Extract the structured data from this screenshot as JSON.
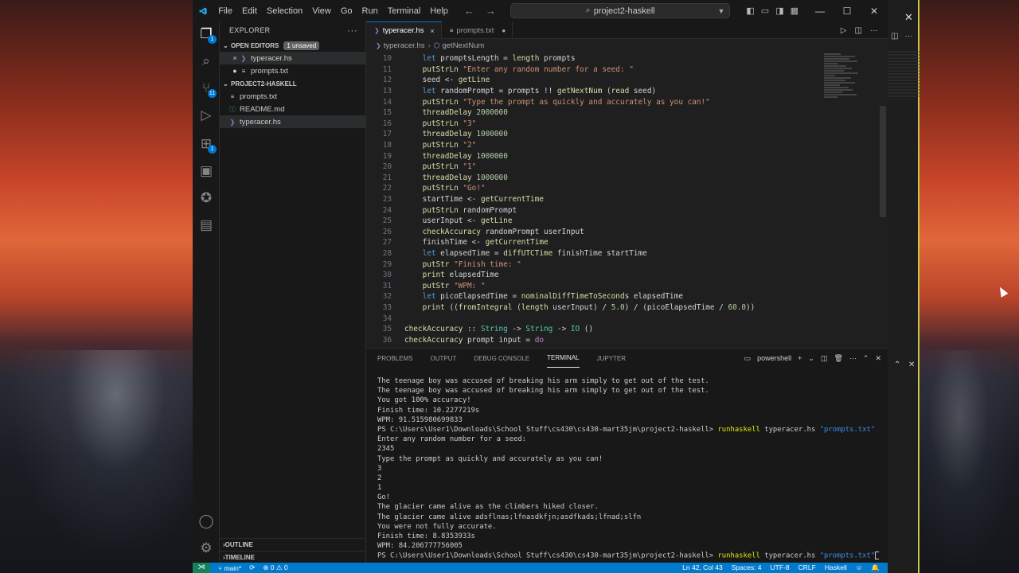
{
  "titlebar": {
    "menu": [
      "File",
      "Edit",
      "Selection",
      "View",
      "Go",
      "Run",
      "Terminal",
      "Help"
    ],
    "search_text": "project2-haskell"
  },
  "sidebar": {
    "header": "EXPLORER",
    "open_editors_label": "OPEN EDITORS",
    "unsaved_badge": "1 unsaved",
    "open_editors": [
      {
        "name": "typeracer.hs",
        "marker": "×"
      },
      {
        "name": "prompts.txt",
        "marker": "●"
      }
    ],
    "project_label": "PROJECT2-HASKELL",
    "files": [
      {
        "name": "prompts.txt"
      },
      {
        "name": "README.md"
      },
      {
        "name": "typeracer.hs"
      }
    ],
    "outline_label": "OUTLINE",
    "timeline_label": "TIMELINE"
  },
  "activity_badges": {
    "source_control": "11",
    "extensions": "1"
  },
  "tabs": [
    {
      "label": "typeracer.hs"
    },
    {
      "label": "prompts.txt"
    }
  ],
  "breadcrumb": {
    "file": "typeracer.hs",
    "symbol": "getNextNum"
  },
  "code_lines": [
    {
      "n": "10",
      "html": "    <span class='kw'>let</span> promptsLength = <span class='fn'>length</span> prompts"
    },
    {
      "n": "11",
      "html": "    <span class='fn'>putStrLn</span> <span class='str'>\"Enter any random number for a seed: \"</span>"
    },
    {
      "n": "12",
      "html": "    seed <- <span class='fn'>getLine</span>"
    },
    {
      "n": "13",
      "html": "    <span class='kw'>let</span> randomPrompt = prompts !! <span class='fn'>getNextNum</span> (<span class='fn'>read</span> seed)"
    },
    {
      "n": "14",
      "html": "    <span class='fn'>putStrLn</span> <span class='str'>\"Type the prompt as quickly and accurately as you can!\"</span>"
    },
    {
      "n": "15",
      "html": "    <span class='fn'>threadDelay</span> <span class='num'>2000000</span>"
    },
    {
      "n": "16",
      "html": "    <span class='fn'>putStrLn</span> <span class='str'>\"3\"</span>"
    },
    {
      "n": "17",
      "html": "    <span class='fn'>threadDelay</span> <span class='num'>1000000</span>"
    },
    {
      "n": "18",
      "html": "    <span class='fn'>putStrLn</span> <span class='str'>\"2\"</span>"
    },
    {
      "n": "19",
      "html": "    <span class='fn'>threadDelay</span> <span class='num'>1000000</span>"
    },
    {
      "n": "20",
      "html": "    <span class='fn'>putStrLn</span> <span class='str'>\"1\"</span>"
    },
    {
      "n": "21",
      "html": "    <span class='fn'>threadDelay</span> <span class='num'>1000000</span>"
    },
    {
      "n": "22",
      "html": "    <span class='fn'>putStrLn</span> <span class='str'>\"Go!\"</span>"
    },
    {
      "n": "23",
      "html": "    startTime <- <span class='fn'>getCurrentTime</span>"
    },
    {
      "n": "24",
      "html": "    <span class='fn'>putStrLn</span> randomPrompt"
    },
    {
      "n": "25",
      "html": "    userInput <- <span class='fn'>getLine</span>"
    },
    {
      "n": "26",
      "html": "    <span class='fn'>checkAccuracy</span> randomPrompt userInput"
    },
    {
      "n": "27",
      "html": "    finishTime <- <span class='fn'>getCurrentTime</span>"
    },
    {
      "n": "28",
      "html": "    <span class='kw'>let</span> elapsedTime = <span class='fn'>diffUTCTime</span> finishTime startTime"
    },
    {
      "n": "29",
      "html": "    <span class='fn'>putStr</span> <span class='str'>\"Finish time: \"</span>"
    },
    {
      "n": "30",
      "html": "    <span class='fn'>print</span> elapsedTime"
    },
    {
      "n": "31",
      "html": "    <span class='fn'>putStr</span> <span class='str'>\"WPM: \"</span>"
    },
    {
      "n": "32",
      "html": "    <span class='kw'>let</span> picoElapsedTime = <span class='fn'>nominalDiffTimeToSeconds</span> elapsedTime"
    },
    {
      "n": "33",
      "html": "    <span class='fn'>print</span> ((<span class='fn'>fromIntegral</span> (<span class='fn'>length</span> userInput) / <span class='num'>5.0</span>) / (picoElapsedTime / <span class='num'>60.0</span>))"
    },
    {
      "n": "34",
      "html": ""
    },
    {
      "n": "35",
      "html": "<span class='fn'>checkAccuracy</span> :: <span class='ty'>String</span> -> <span class='ty'>String</span> -> <span class='ty'>IO</span> ()"
    },
    {
      "n": "36",
      "html": "<span class='fn'>checkAccuracy</span> prompt input = <span class='kw2'>do</span>"
    }
  ],
  "panel": {
    "tabs": [
      "PROBLEMS",
      "OUTPUT",
      "DEBUG CONSOLE",
      "TERMINAL",
      "JUPYTER"
    ],
    "shell_label": "powershell"
  },
  "terminal": {
    "lines_before": [
      "The teenage boy was accused of breaking his arm simply to get out of the test.",
      "The teenage boy was accused of breaking his arm simply to get out of the test.",
      "You got 100% accuracy!",
      "Finish time: 10.2277219s",
      "WPM: 91.515980699833"
    ],
    "prompt_path": "PS C:\\Users\\User1\\Downloads\\School Stuff\\cs430\\cs430-mart35jm\\project2-haskell> ",
    "cmd": "runhaskell",
    "cmd_args": " typeracer.hs ",
    "cmd_file": "\"prompts.txt\"",
    "lines_after": [
      "Enter any random number for a seed:",
      "2345",
      "Type the prompt as quickly and accurately as you can!",
      "3",
      "2",
      "1",
      "Go!",
      "The glacier came alive as the climbers hiked closer.",
      "The glacier came alive adsflnas;lfnasdkfjn;asdfkads;lfnad;slfn",
      "You were not fully accurate.",
      "Finish time: 8.8353933s",
      "WPM: 84.206777756005"
    ]
  },
  "statusbar": {
    "branch": "main*",
    "problems": "⊗ 0 ⚠ 0",
    "position": "Ln 42, Col 43",
    "spaces": "Spaces: 4",
    "encoding": "UTF-8",
    "eol": "CRLF",
    "language": "Haskell"
  },
  "colors": {
    "accent": "#007acc",
    "terminal_cmd": "#e5e510",
    "terminal_str": "#3b8eea"
  },
  "icons": [
    "vscode-logo-icon",
    "files-icon",
    "search-icon",
    "source-control-icon",
    "run-debug-icon",
    "extensions-icon",
    "remote-explorer-icon",
    "python-icon",
    "notebook-icon",
    "account-icon",
    "settings-gear-icon"
  ]
}
